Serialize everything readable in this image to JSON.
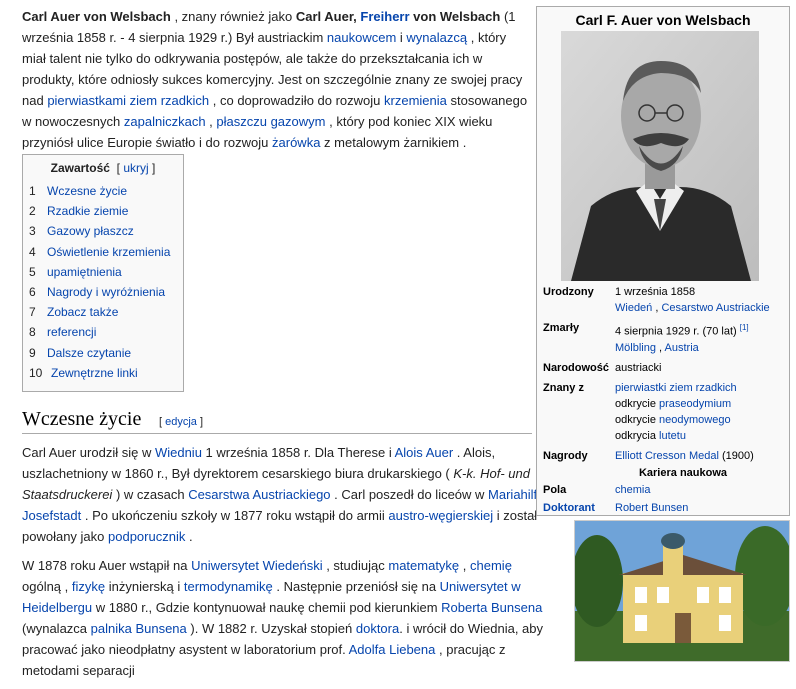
{
  "intro": {
    "name": "Carl Auer von Welsbach",
    "t1": " , znany również jako ",
    "name2": "Carl Auer,",
    "freiherr": "Freiherr",
    "t2": " von Welsbach",
    "t3": " (1 września 1858 r. - 4 sierpnia 1929 r.) Był austriackim ",
    "l_naukowcem": "naukowcem",
    "t4": " i ",
    "l_wynalazca": "wynalazcą",
    "t5": " , który miał talent nie tylko do odkrywania postępów, ale także do przekształcania ich w produkty, które odniosły sukces komercyjny. Jest on szczególnie znany ze swojej pracy nad ",
    "l_pierwiastki": "pierwiastkami ziem rzadkich",
    "t6": " , co doprowadziło do rozwoju ",
    "l_krzemienia": "krzemienia",
    "t7": " stosowanego w nowoczesnych ",
    "l_zapalniczkach": "zapalniczkach",
    "t8": " , ",
    "l_plaszczu": "płaszczu gazowym",
    "t9": " , który pod koniec XIX wieku przyniósł ulice Europie światło i do rozwoju ",
    "l_zarowka": "żarówka",
    "t10": " z metalowym żarnikiem ."
  },
  "toc": {
    "title": "Zawartość",
    "hide_prefix": "[ ",
    "hide": "ukryj",
    "hide_suffix": " ]",
    "items": [
      {
        "num": "1",
        "label": "Wczesne życie"
      },
      {
        "num": "2",
        "label": "Rzadkie ziemie"
      },
      {
        "num": "3",
        "label": "Gazowy płaszcz"
      },
      {
        "num": "4",
        "label": "Oświetlenie krzemienia"
      },
      {
        "num": "5",
        "label": "upamiętnienia"
      },
      {
        "num": "6",
        "label": "Nagrody i wyróżnienia"
      },
      {
        "num": "7",
        "label": "Zobacz także"
      },
      {
        "num": "8",
        "label": "referencji"
      },
      {
        "num": "9",
        "label": "Dalsze czytanie"
      },
      {
        "num": "10",
        "label": "Zewnętrzne linki"
      }
    ]
  },
  "section": {
    "title": "Wczesne życie",
    "edit_prefix": "[ ",
    "edit": "edycja",
    "edit_suffix": " ]"
  },
  "p1": {
    "a": "Carl Auer urodził się w ",
    "l_wiedniu": "Wiedniu",
    "b": " 1 września 1858 r. Dla Therese i ",
    "l_alois": "Alois Auer",
    "c": " . Alois, uszlachetniony w 1860 r., Był dyrektorem cesarskiego biura drukarskiego ( ",
    "ital": "K-k. Hof- und Staatsdruckerei",
    "d": " ) w czasach ",
    "l_cesarstwa": "Cesarstwa Austriackiego",
    "e": " . Carl poszedł do liceów w ",
    "l_mariahilf": "Mariahilf",
    "f": " i ",
    "l_josefstadt": "Josefstadt",
    "g": " . Po ukończeniu szkoły w 1877 roku wstąpił do armii ",
    "l_austro": "austro-węgierskiej",
    "h": " i został powołany jako ",
    "l_podporucznik": "podporucznik",
    "i": " ."
  },
  "p2": {
    "a": "W 1878 roku Auer wstąpił na ",
    "l_uniw": "Uniwersytet Wiedeński",
    "b": " , studiując ",
    "l_mat": "matematykę",
    "c": " , ",
    "l_chem": "chemię",
    "d": " ogólną , ",
    "l_fiz": "fizykę",
    "e": " inżynierską i ",
    "l_termo": "termodynamikę",
    "f": " . Następnie przeniósł się na ",
    "l_heid": "Uniwersytet w Heidelbergu",
    "g": " w 1880 r., Gdzie kontynuował naukę chemii pod kierunkiem ",
    "l_bunsen": "Roberta Bunsena",
    "h": " (wynalazca ",
    "l_palnik": "palnika Bunsena",
    "i": " ). W 1882 r. Uzyskał stopień ",
    "l_doktor": "doktora",
    "j": ". i wrócił do Wiednia, aby pracować jako nieodpłatny asystent w laboratorium prof. ",
    "l_lieben": "Adolfa Liebena",
    "k": " , pracując z metodami separacji"
  },
  "infobox": {
    "title": "Carl F. Auer von Welsbach",
    "born_label": "Urodzony",
    "born_date": "1 września 1858",
    "born_place1": "Wiedeń",
    "born_sep": " , ",
    "born_place2": "Cesarstwo Austriackie",
    "died_label": "Zmarły",
    "died_date": "4 sierpnia 1929 r. (70 lat) ",
    "died_ref": "[1]",
    "died_place1": "Mölbling",
    "died_sep": " , ",
    "died_place2": "Austria",
    "nat_label": "Narodowość",
    "nat_val": "austriacki",
    "known_label": "Znany z",
    "known_l1": "pierwiastki ziem rzadkich",
    "known_t2": "odkrycie ",
    "known_l2": "praseodymium",
    "known_t3": "odkrycie ",
    "known_l3": "neodymowego",
    "known_t4": "odkrycia ",
    "known_l4": "lutetu",
    "awards_label": "Nagrody",
    "awards_link": "Elliott Cresson Medal",
    "awards_year": " (1900)",
    "career": "Kariera naukowa",
    "field_label": "Pola",
    "field_val": "chemia",
    "advisor_label": "Doktorant",
    "advisor_val": "Robert Bunsen"
  }
}
